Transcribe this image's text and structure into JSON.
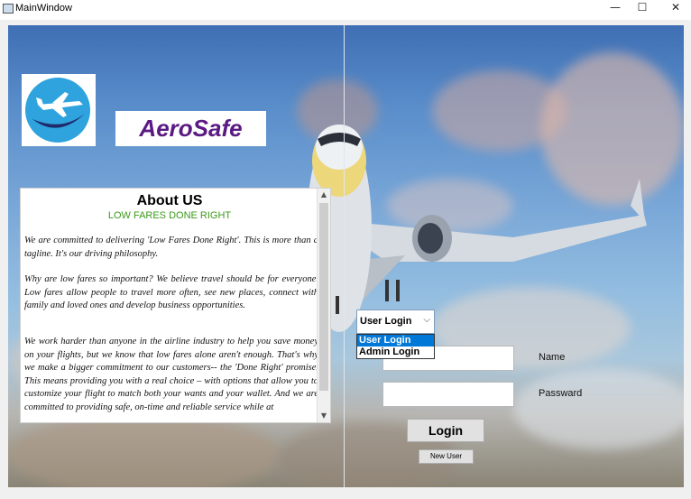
{
  "window": {
    "title": "MainWindow",
    "min_glyph": "—",
    "max_glyph": "☐",
    "close_glyph": "✕"
  },
  "brand": {
    "name": "AeroSafe"
  },
  "about": {
    "title": "About US",
    "tagline": "LOW FARES DONE RIGHT",
    "paragraphs": [
      "We are committed to delivering 'Low Fares Done Right'. This is more than a tagline. It's our driving philosophy.",
      "Why are low fares so important? We believe travel should be for everyone. Low fares allow people to travel more often, see new places, connect with family and loved ones and develop business opportunities.",
      "We work harder than anyone in the airline industry to help you save money on your flights, but we know that low fares alone aren't enough. That's why we make a bigger commitment to our customers-- the 'Done Right' promise. This means providing you with a real choice – with options that allow you to customize your flight to match both your wants and your wallet. And we are committed to providing safe, on-time and reliable service while at"
    ],
    "scroll_up": "▲",
    "scroll_down": "▼"
  },
  "login": {
    "role_selected": "User Login",
    "role_arrow": "⌵",
    "role_options": [
      "User Login",
      "Admin Login"
    ],
    "name_label": "Name",
    "password_label": "Passward",
    "name_value": "",
    "password_value": "",
    "login_button": "Login",
    "new_user_button": "New User"
  },
  "colors": {
    "brand_purple": "#5b1a83",
    "tagline_green": "#3a9a1a",
    "selection_blue": "#0078d7",
    "logo_blue": "#2ea3dd"
  },
  "icons": [
    "app-icon",
    "airplane-logo-icon",
    "minimize-icon",
    "maximize-icon",
    "close-icon",
    "chevron-down-icon"
  ]
}
